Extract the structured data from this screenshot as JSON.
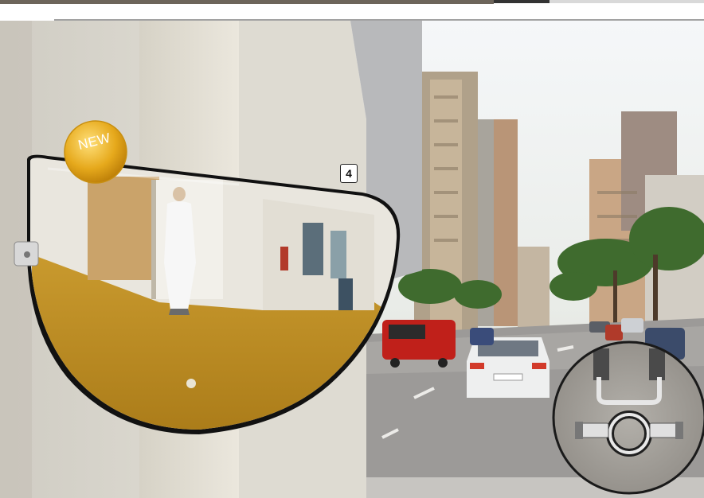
{
  "badge": {
    "text": "NEW"
  },
  "marker": {
    "number": "4"
  }
}
